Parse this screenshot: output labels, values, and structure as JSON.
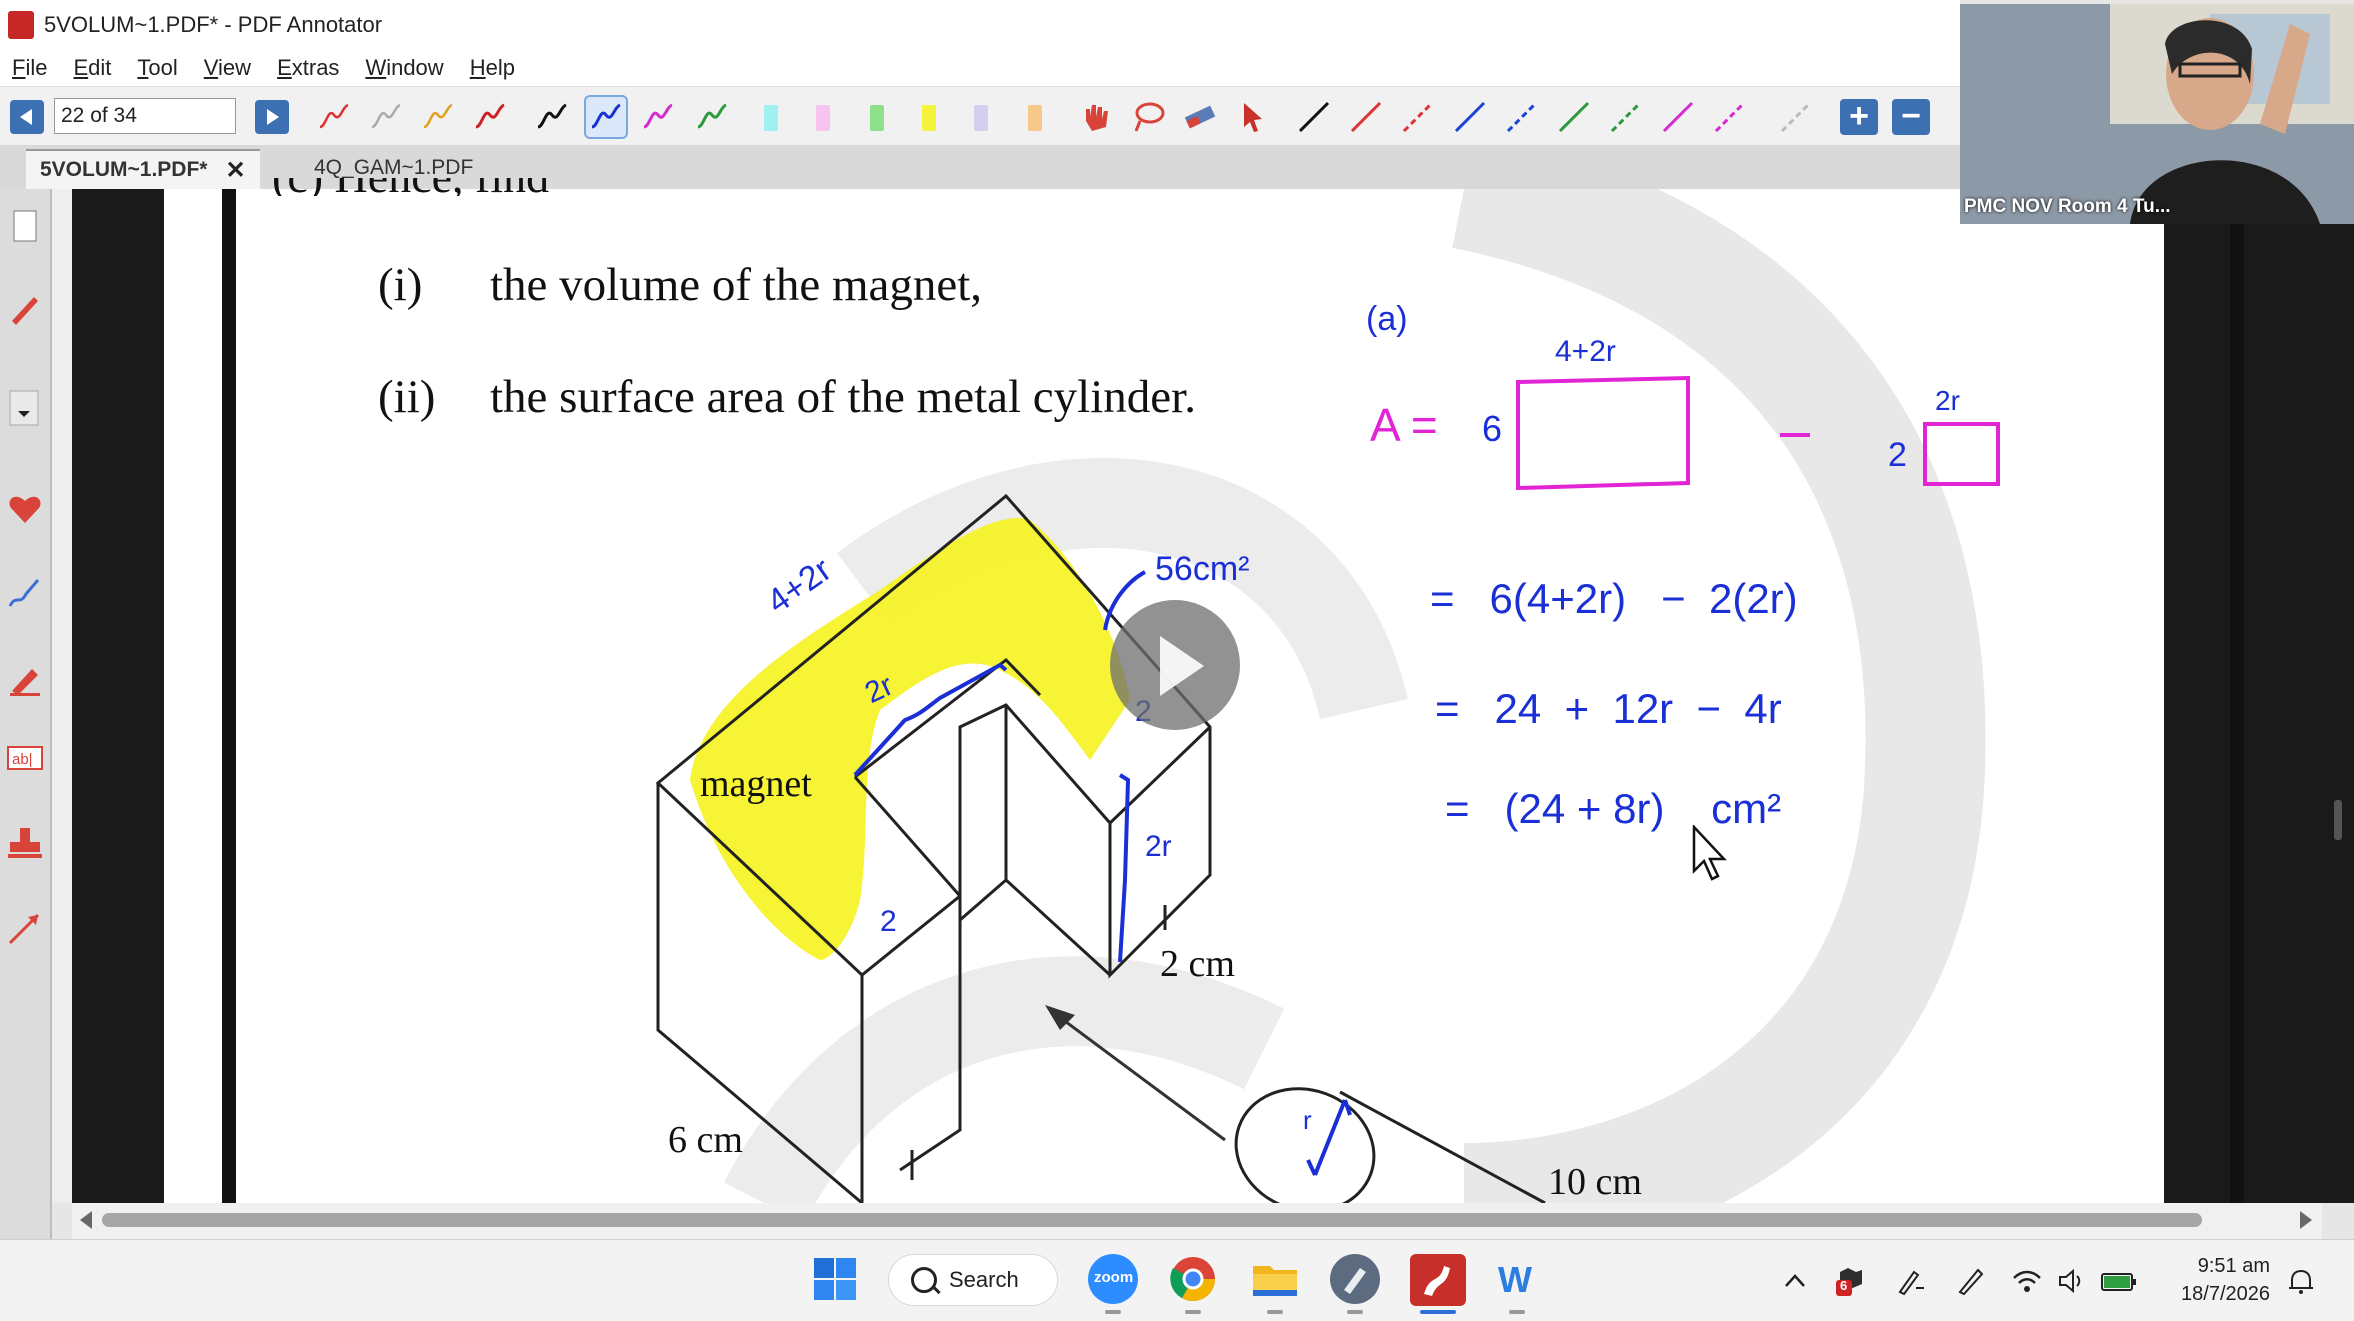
{
  "window": {
    "title": "5VOLUM~1.PDF* - PDF Annotator"
  },
  "menu": [
    "File",
    "Edit",
    "Tool",
    "View",
    "Extras",
    "Window",
    "Help"
  ],
  "toolbar": {
    "page_indicator": "22 of 34"
  },
  "tabs": [
    {
      "label": "5VOLUM~1.PDF*",
      "active": true,
      "close": "✕"
    },
    {
      "label": "4Q_GAM~1.PDF",
      "active": false
    }
  ],
  "document": {
    "heading_partial": "(c)   Hence, find",
    "item_i_num": "(i)",
    "item_i_text": "the volume of the magnet,",
    "item_ii_num": "(ii)",
    "item_ii_text": "the surface area of the metal cylinder.",
    "figure_label_magnet": "magnet",
    "figure_label_2cm": "2 cm",
    "figure_label_6cm": "6 cm",
    "figure_label_10cm": "10 cm"
  },
  "annotations": {
    "part": "(a)",
    "big_rect_label": "4+2r",
    "A_eq": "A =",
    "six": "6",
    "minus": "−",
    "small_rect_label": "2r",
    "two": "2",
    "line1": "=   6(4+2r)   −  2(2r)",
    "line2": "=   24  +  12r  −  4r",
    "line3": "=   (24 + 8r)    cm²",
    "fig_4plus2r": "4+2r",
    "fig_56cm2": "56cm²",
    "fig_2r_top": "2r",
    "fig_2r_side": "2r",
    "fig_2_a": "2",
    "fig_2_b": "2",
    "fig_r": "r"
  },
  "webcam": {
    "label": "PMC NOV Room 4 Tu..."
  },
  "taskbar": {
    "search_label": "Search",
    "zoom_label": "zoom",
    "notification_count": "6",
    "time": "9:51 am",
    "date": "18/7/2026"
  },
  "colors": {
    "toolbar_blue": "#3d6fb3",
    "highlight_yellow": "#f6f32a",
    "ink_blue": "#1a2fd6",
    "ink_magenta": "#e024d6"
  }
}
